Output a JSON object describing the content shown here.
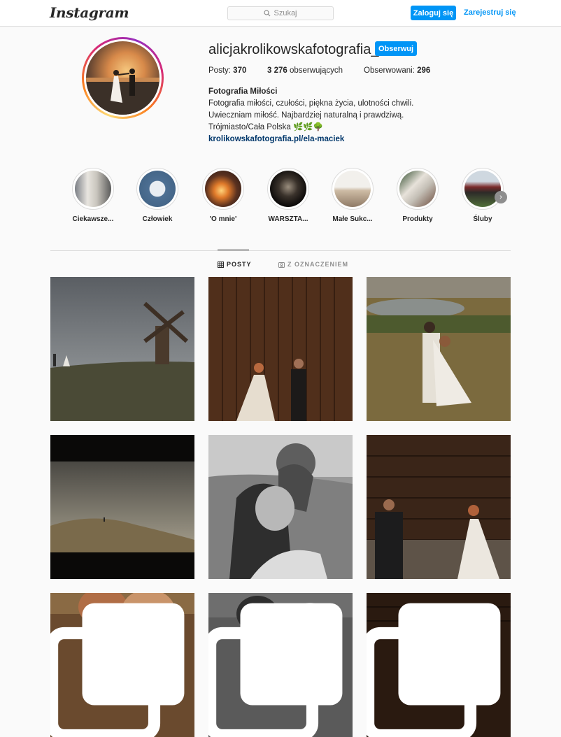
{
  "header": {
    "logo": "Instagram",
    "search_placeholder": "Szukaj",
    "login_label": "Zaloguj się",
    "signup_label": "Zarejestruj się"
  },
  "profile": {
    "username": "alicjakrolikowskafotografia_",
    "follow_label": "Obserwuj",
    "posts_label": "Posty:",
    "posts_count": "370",
    "followers_count": "3 276",
    "followers_label": "obserwujących",
    "following_label": "Obserwowani:",
    "following_count": "296",
    "full_name": "Fotografia Miłości",
    "bio_line1": "Fotografia miłości, czułości, piękna życia, ulotności chwili.",
    "bio_line2": "Uwieczniam miłość. Najbardziej naturalną i prawdziwą.",
    "bio_line3": "Trójmiasto/Cała Polska 🌿🌿🌳",
    "website": "krolikowskafotografia.pl/ela-maciek"
  },
  "highlights": [
    {
      "label": "Ciekawsze..."
    },
    {
      "label": "Człowiek"
    },
    {
      "label": "'O mnie'"
    },
    {
      "label": "WARSZTA..."
    },
    {
      "label": "Małe Sukc..."
    },
    {
      "label": "Produkty"
    },
    {
      "label": "Śluby"
    }
  ],
  "tabs": {
    "posts": "POSTY",
    "tagged": "Z OZNACZENIEM"
  },
  "icons": {
    "search": "search-icon",
    "grid": "grid-icon",
    "tag": "tag-icon",
    "next": "chevron-right-icon",
    "multi": "carousel-icon"
  },
  "colors": {
    "accent": "#0095f6",
    "link": "#00376b",
    "text": "#262626",
    "muted": "#8e8e8e",
    "border": "#dbdbdb"
  }
}
